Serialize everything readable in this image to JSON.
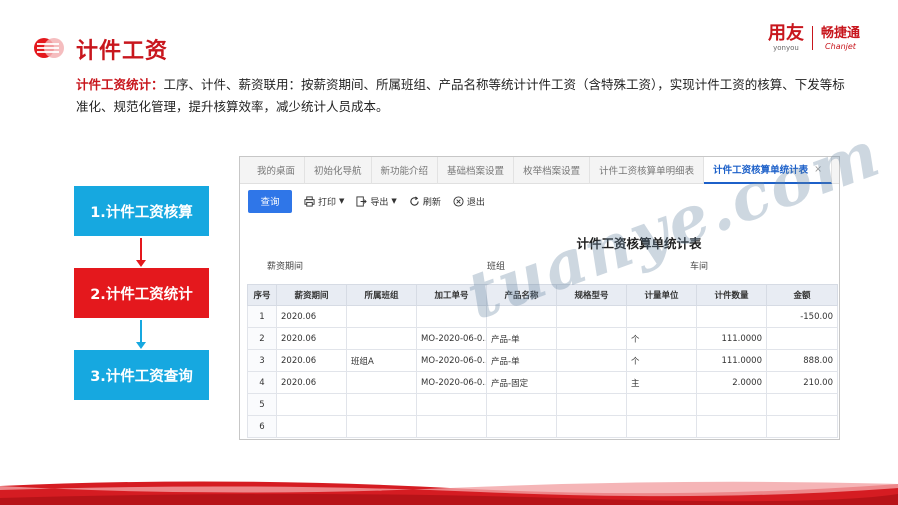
{
  "header": {
    "title": "计件工资",
    "brand_primary_cn": "用友",
    "brand_primary_en": "yonyou",
    "brand_secondary_cn": "畅捷通",
    "brand_secondary_en": "Chanjet"
  },
  "intro": {
    "lead": "计件工资统计：",
    "text": "工序、计件、薪资联用：按薪资期间、所属班组、产品名称等统计计件工资（含特殊工资），实现计件工资的核算、下发等标准化、规范化管理，提升核算效率，减少统计人员成本。"
  },
  "steps": [
    {
      "label": "1.计件工资核算"
    },
    {
      "label": "2.计件工资统计"
    },
    {
      "label": "3.计件工资查询"
    }
  ],
  "app": {
    "tabs": [
      {
        "label": "我的桌面"
      },
      {
        "label": "初始化导航"
      },
      {
        "label": "新功能介绍"
      },
      {
        "label": "基础档案设置"
      },
      {
        "label": "枚举档案设置"
      },
      {
        "label": "计件工资核算单明细表"
      },
      {
        "label": "计件工资核算单统计表"
      }
    ],
    "tab_close": "×",
    "toolbar": {
      "query": "查询",
      "print": "打印",
      "export": "导出",
      "refresh": "刷新",
      "exit": "退出"
    },
    "report_title": "计件工资核算单统计表",
    "filters": {
      "period": "薪资期间",
      "group": "班组",
      "workshop": "车间"
    },
    "columns": [
      "序号",
      "薪资期间",
      "所属班组",
      "加工单号",
      "产品名称",
      "规格型号",
      "计量单位",
      "计件数量",
      "金额"
    ],
    "rows": [
      {
        "no": "1",
        "period": "2020.06",
        "group": "",
        "order": "",
        "product": "",
        "spec": "",
        "unit": "",
        "qty": "",
        "amount": "-150.00"
      },
      {
        "no": "2",
        "period": "2020.06",
        "group": "",
        "order": "MO-2020-06-0...",
        "product": "产品-单",
        "spec": "",
        "unit": "个",
        "qty": "111.0000",
        "amount": ""
      },
      {
        "no": "3",
        "period": "2020.06",
        "group": "班组A",
        "order": "MO-2020-06-0...",
        "product": "产品-单",
        "spec": "",
        "unit": "个",
        "qty": "111.0000",
        "amount": "888.00"
      },
      {
        "no": "4",
        "period": "2020.06",
        "group": "",
        "order": "MO-2020-06-0...",
        "product": "产品-固定",
        "spec": "",
        "unit": "主",
        "qty": "2.0000",
        "amount": "210.00"
      },
      {
        "no": "5",
        "period": "",
        "group": "",
        "order": "",
        "product": "",
        "spec": "",
        "unit": "",
        "qty": "",
        "amount": ""
      },
      {
        "no": "6",
        "period": "",
        "group": "",
        "order": "",
        "product": "",
        "spec": "",
        "unit": "",
        "qty": "",
        "amount": ""
      }
    ]
  },
  "watermark": "tuanye.com",
  "colors": {
    "accent_red": "#c8161d",
    "step_blue": "#16a8e0",
    "step_red": "#e4181d",
    "query_blue": "#2f76e8"
  }
}
